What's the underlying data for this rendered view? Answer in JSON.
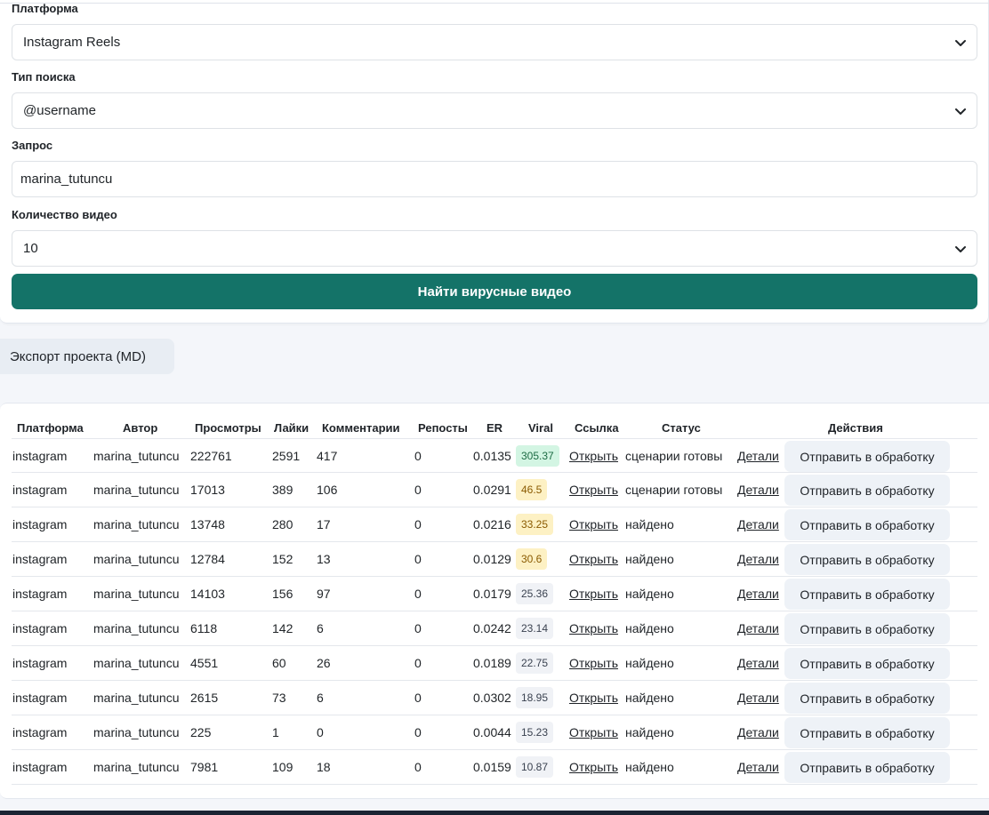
{
  "form": {
    "platform_label": "Платформа",
    "platform_value": "Instagram Reels",
    "search_type_label": "Тип поиска",
    "search_type_value": "@username",
    "query_label": "Запрос",
    "query_value": "marina_tutuncu",
    "count_label": "Количество видео",
    "count_value": "10",
    "submit_label": "Найти вирусные видео"
  },
  "export_label": "Экспорт проекта (MD)",
  "table": {
    "headers": [
      "Платформа",
      "Автор",
      "Просмотры",
      "Лайки",
      "Комментарии",
      "Репосты",
      "ER",
      "Viral",
      "Ссылка",
      "Статус",
      "Действия"
    ],
    "rows": [
      {
        "platform": "instagram",
        "author": "marina_tutuncu",
        "views": "222761",
        "likes": "2591",
        "comments": "417",
        "reposts": "0",
        "er": "0.0135",
        "viral": "305.37",
        "link": "Открыть",
        "status": "сценарии готовы",
        "details": "Детали",
        "action": "Отправить в обработку"
      },
      {
        "platform": "instagram",
        "author": "marina_tutuncu",
        "views": "17013",
        "likes": "389",
        "comments": "106",
        "reposts": "0",
        "er": "0.0291",
        "viral": "46.5",
        "link": "Открыть",
        "status": "сценарии готовы",
        "details": "Детали",
        "action": "Отправить в обработку"
      },
      {
        "platform": "instagram",
        "author": "marina_tutuncu",
        "views": "13748",
        "likes": "280",
        "comments": "17",
        "reposts": "0",
        "er": "0.0216",
        "viral": "33.25",
        "link": "Открыть",
        "status": "найдено",
        "details": "Детали",
        "action": "Отправить в обработку"
      },
      {
        "platform": "instagram",
        "author": "marina_tutuncu",
        "views": "12784",
        "likes": "152",
        "comments": "13",
        "reposts": "0",
        "er": "0.0129",
        "viral": "30.6",
        "link": "Открыть",
        "status": "найдено",
        "details": "Детали",
        "action": "Отправить в обработку"
      },
      {
        "platform": "instagram",
        "author": "marina_tutuncu",
        "views": "14103",
        "likes": "156",
        "comments": "97",
        "reposts": "0",
        "er": "0.0179",
        "viral": "25.36",
        "link": "Открыть",
        "status": "найдено",
        "details": "Детали",
        "action": "Отправить в обработку"
      },
      {
        "platform": "instagram",
        "author": "marina_tutuncu",
        "views": "6118",
        "likes": "142",
        "comments": "6",
        "reposts": "0",
        "er": "0.0242",
        "viral": "23.14",
        "link": "Открыть",
        "status": "найдено",
        "details": "Детали",
        "action": "Отправить в обработку"
      },
      {
        "platform": "instagram",
        "author": "marina_tutuncu",
        "views": "4551",
        "likes": "60",
        "comments": "26",
        "reposts": "0",
        "er": "0.0189",
        "viral": "22.75",
        "link": "Открыть",
        "status": "найдено",
        "details": "Детали",
        "action": "Отправить в обработку"
      },
      {
        "platform": "instagram",
        "author": "marina_tutuncu",
        "views": "2615",
        "likes": "73",
        "comments": "6",
        "reposts": "0",
        "er": "0.0302",
        "viral": "18.95",
        "link": "Открыть",
        "status": "найдено",
        "details": "Детали",
        "action": "Отправить в обработку"
      },
      {
        "platform": "instagram",
        "author": "marina_tutuncu",
        "views": "225",
        "likes": "1",
        "comments": "0",
        "reposts": "0",
        "er": "0.0044",
        "viral": "15.23",
        "link": "Открыть",
        "status": "найдено",
        "details": "Детали",
        "action": "Отправить в обработку"
      },
      {
        "platform": "instagram",
        "author": "marina_tutuncu",
        "views": "7981",
        "likes": "109",
        "comments": "18",
        "reposts": "0",
        "er": "0.0159",
        "viral": "10.87",
        "link": "Открыть",
        "status": "найдено",
        "details": "Детали",
        "action": "Отправить в обработку"
      }
    ]
  },
  "colors": {
    "accent": "#147368",
    "viral_high": "#d3f5e3",
    "viral_mid": "#fdf1c4",
    "viral_low": "#f0f2f6"
  }
}
